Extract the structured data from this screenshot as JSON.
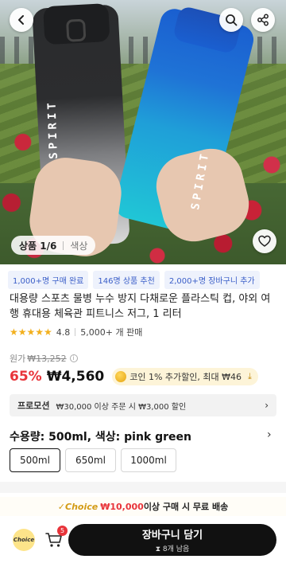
{
  "hero": {
    "gallery_label": "상품 1/6",
    "color_label": "색상",
    "brand_text": "SPIRIT"
  },
  "icons": {
    "back": "chevron-left-icon",
    "search": "search-icon",
    "share": "share-icon",
    "wishlist": "heart-icon",
    "cart": "cart-icon"
  },
  "badges": [
    "1,000+명 구매 완료",
    "146명 상품 추천",
    "2,000+명 장바구니 추가"
  ],
  "product": {
    "title": "대용량 스포츠 물병 누수 방지 다채로운 플라스틱 컵, 야외 여행 휴대용 체육관 피트니스 저그, 1 리터",
    "stars": "★★★★★",
    "rating": "4.8",
    "sold": "5,000+ 개 판매",
    "original_label": "원가",
    "original_price": "₩13,252",
    "discount": "65%",
    "price": "₩4,560",
    "coin_text": "코인 1% 추가할인, 최대 ₩46"
  },
  "promotion": {
    "label": "프로모션",
    "text": "₩30,000 이상 주문 시 ₩3,000 할인"
  },
  "options": {
    "title": "수용량: 500ml, 색상: pink green",
    "items": [
      "500ml",
      "650ml",
      "1000ml"
    ]
  },
  "shipping": {
    "choice": "Choice",
    "amount": "₩10,000",
    "text": "이상 구매 시 무료 배송"
  },
  "bottom": {
    "choice_logo": "Choice",
    "cart_count": "5",
    "add_to_cart": "장바구니 담기",
    "stock": "8개 남음"
  },
  "colors": {
    "accent_red": "#e8343a",
    "badge_blue": "#3a5ec8",
    "button_black": "#111111",
    "coin_gold": "#e5a413"
  }
}
